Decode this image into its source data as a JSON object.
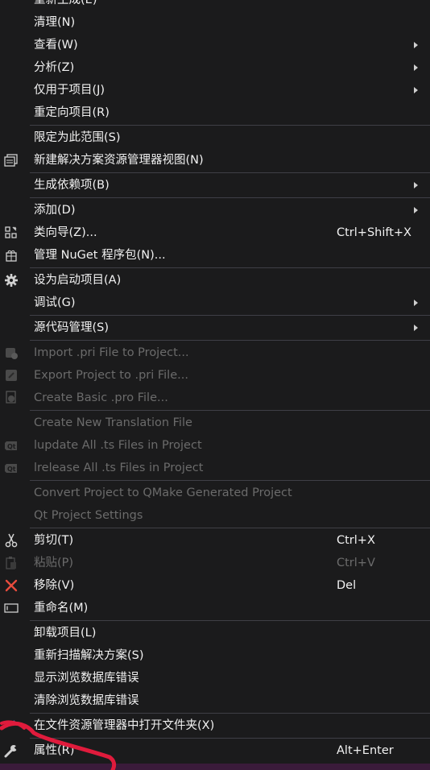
{
  "colors": {
    "background": "#1b1b1c",
    "text": "#f1f1f1",
    "disabled": "#6b6b6b",
    "separator": "#3f3f46",
    "remove_icon": "#e84c3d",
    "annotation": "#e01b3c"
  },
  "menu": {
    "items": [
      {
        "label": "重新生成(E)"
      },
      {
        "label": "清理(N)"
      },
      {
        "label": "查看(W)",
        "submenu": true
      },
      {
        "label": "分析(Z)",
        "submenu": true
      },
      {
        "label": "仅用于项目(J)",
        "submenu": true
      },
      {
        "label": "重定向项目(R)"
      },
      {
        "label": "限定为此范围(S)"
      },
      {
        "label": "新建解决方案资源管理器视图(N)",
        "icon": "solution-explorer-view-icon"
      },
      {
        "label": "生成依赖项(B)",
        "submenu": true
      },
      {
        "label": "添加(D)",
        "submenu": true
      },
      {
        "label": "类向导(Z)...",
        "icon": "class-wizard-icon",
        "shortcut": "Ctrl+Shift+X"
      },
      {
        "label": "管理 NuGet 程序包(N)...",
        "icon": "nuget-package-icon"
      },
      {
        "label": "设为启动项目(A)",
        "icon": "gear-icon"
      },
      {
        "label": "调试(G)",
        "submenu": true
      },
      {
        "label": "源代码管理(S)",
        "submenu": true
      },
      {
        "label": "Import .pri File to Project...",
        "icon": "import-pri-icon",
        "disabled": true
      },
      {
        "label": "Export Project to .pri File...",
        "icon": "export-pri-icon",
        "disabled": true
      },
      {
        "label": "Create Basic .pro File...",
        "icon": "create-pro-icon",
        "disabled": true
      },
      {
        "label": "Create New Translation File",
        "disabled": true
      },
      {
        "label": "lupdate All .ts Files in Project",
        "icon": "qt-icon",
        "disabled": true
      },
      {
        "label": "lrelease All .ts Files in Project",
        "icon": "qt-icon",
        "disabled": true
      },
      {
        "label": "Convert Project to QMake Generated Project",
        "disabled": true
      },
      {
        "label": "Qt Project Settings",
        "disabled": true
      },
      {
        "label": "剪切(T)",
        "icon": "scissors-icon",
        "shortcut": "Ctrl+X"
      },
      {
        "label": "粘贴(P)",
        "icon": "paste-icon",
        "shortcut": "Ctrl+V",
        "disabled": true
      },
      {
        "label": "移除(V)",
        "icon": "remove-x-icon",
        "shortcut": "Del"
      },
      {
        "label": "重命名(M)",
        "icon": "rename-icon"
      },
      {
        "label": "卸载项目(L)"
      },
      {
        "label": "重新扫描解决方案(S)"
      },
      {
        "label": "显示浏览数据库错误"
      },
      {
        "label": "清除浏览数据库错误"
      },
      {
        "label": "在文件资源管理器中打开文件夹(X)",
        "icon": "open-folder-icon"
      },
      {
        "label": "属性(R)",
        "icon": "wrench-icon",
        "shortcut": "Alt+Enter"
      }
    ]
  }
}
